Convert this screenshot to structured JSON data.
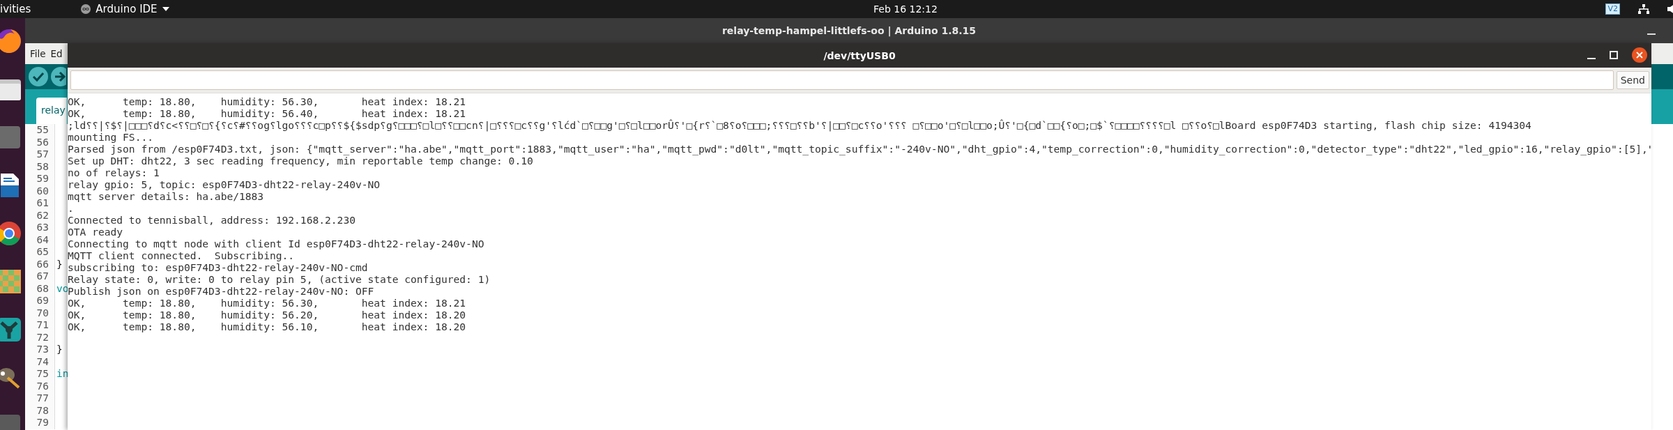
{
  "top_bar": {
    "activities": "ivities",
    "app_menu": "Arduino IDE",
    "clock": "Feb 16  12:12",
    "indicator": "V2"
  },
  "main_window": {
    "title": "relay-temp-hampel-littlefs-oo | Arduino 1.8.15",
    "menu": [
      "File",
      "Ed"
    ],
    "tab": "relay",
    "editor_lines": [
      {
        "number": "55"
      },
      {
        "number": "56"
      },
      {
        "number": "57"
      },
      {
        "number": "58"
      },
      {
        "number": "59"
      },
      {
        "number": "60"
      },
      {
        "number": "61"
      },
      {
        "number": "62"
      },
      {
        "number": "63"
      },
      {
        "number": "64"
      },
      {
        "number": "65"
      },
      {
        "number": "66",
        "code": "}",
        "kind": "plain"
      },
      {
        "number": "67"
      },
      {
        "number": "68",
        "code": "vo",
        "kind": "keyword"
      },
      {
        "number": "69"
      },
      {
        "number": "70"
      },
      {
        "number": "71"
      },
      {
        "number": "72"
      },
      {
        "number": "73",
        "code": "}",
        "kind": "plain"
      },
      {
        "number": "74"
      },
      {
        "number": "75",
        "code": "in",
        "kind": "keyword"
      },
      {
        "number": "76"
      },
      {
        "number": "77"
      },
      {
        "number": "78"
      },
      {
        "number": "79"
      }
    ]
  },
  "serial_monitor": {
    "title": "/dev/ttyUSB0",
    "send_button": "Send",
    "lines": [
      "OK,      temp: 18.80,    humidity: 56.30,       heat index: 18.21",
      "OK,      temp: 18.80,    humidity: 56.40,       heat index: 18.21",
      ";ld⸮⸮|⸮$⸮|□□□⸮d⸮c<⸮⸮□⸮□⸮{⸮c⸮#⸮⸮og⸮lgo⸮⸮⸮c□p⸮⸮${$sdp⸮g⸮□□□⸮□l□⸮⸮□□cn⸮|□⸮⸮⸮□c⸮⸮g'⸮lćd`□⸮□□g'□⸮□l□□orÛ⸮'□{r⸮`□8⸮o⸮□□□;⸮⸮⸮□⸮⸮b'⸮|□□⸮□c⸮⸮o'⸮⸮⸮ □⸮□□o'□⸮□l□□o;Û⸮'□{□d`□□{⸮o□;□$`⸮□□□□⸮⸮⸮⸮□l □⸮⸮o⸮□lBoard esp0F74D3 starting, flash chip size: 4194304",
      "mounting FS...",
      "Parsed json from /esp0F74D3.txt, json: {\"mqtt_server\":\"ha.abe\",\"mqtt_port\":1883,\"mqtt_user\":\"ha\",\"mqtt_pwd\":\"d0lt\",\"mqtt_topic_suffix\":\"-240v-NO\",\"dht_gpio\":4,\"temp_correction\":0,\"humidity_correction\":0,\"detector_type\":\"dht22\",\"led_gpio\":16,\"relay_gpio\":[5],\"",
      "Set up DHT: dht22, 3 sec reading frequency, min reportable temp change: 0.10",
      "no of relays: 1",
      "relay gpio: 5, topic: esp0F74D3-dht22-relay-240v-NO",
      "mqtt server details: ha.abe/1883",
      ".",
      "Connected to tennisball, address: 192.168.2.230",
      "OTA ready",
      "Connecting to mqtt node with client Id esp0F74D3-dht22-relay-240v-NO",
      "MQTT client connected.  Subscribing..",
      "subscribing to: esp0F74D3-dht22-relay-240v-NO-cmd",
      "Relay state: 0, write: 0 to relay pin 5, (active state configured: 1)",
      "Publish json on esp0F74D3-dht22-relay-240v-NO: OFF",
      "OK,      temp: 18.80,    humidity: 56.30,       heat index: 18.21",
      "OK,      temp: 18.80,    humidity: 56.20,       heat index: 18.20",
      "OK,      temp: 18.80,    humidity: 56.10,       heat index: 18.20"
    ]
  }
}
